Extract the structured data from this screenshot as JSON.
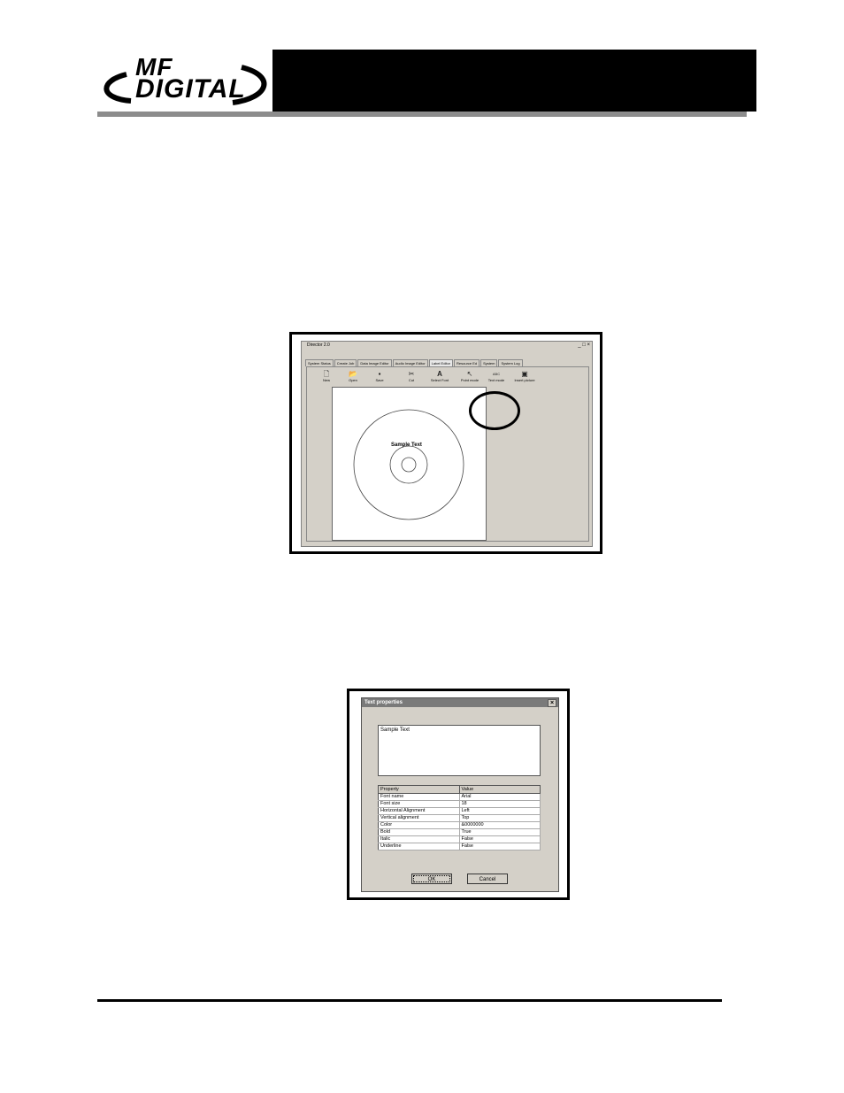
{
  "logo": {
    "line1": "MF",
    "line2": "DIGITAL"
  },
  "window1": {
    "title": "Director 2.0",
    "controls": "_ □ ×",
    "tabs": [
      "System Status",
      "Create Job",
      "Data Image Editor",
      "Audio Image Editor",
      "Label Editor",
      "Resource Ed",
      "System",
      "System Log"
    ],
    "toolbar": [
      "New",
      "Open",
      "Save",
      "Cut",
      "Select Font",
      "Point mode",
      "Text mode",
      "Insert picture"
    ],
    "canvas_text": "Sample Text"
  },
  "dialog": {
    "title": "Text properties",
    "text_value": "Sample Text",
    "columns": [
      "Property",
      "Value"
    ],
    "rows": [
      [
        "Font name",
        "Arial"
      ],
      [
        "Font size",
        "18"
      ],
      [
        "Horizontal Alignment",
        "Left"
      ],
      [
        "Vertical alignment",
        "Top"
      ],
      [
        "Color",
        "&0000000"
      ],
      [
        "Bold",
        "True"
      ],
      [
        "Italic",
        "False"
      ],
      [
        "Underline",
        "False"
      ]
    ],
    "ok_label": "OK",
    "cancel_label": "Cancel"
  }
}
